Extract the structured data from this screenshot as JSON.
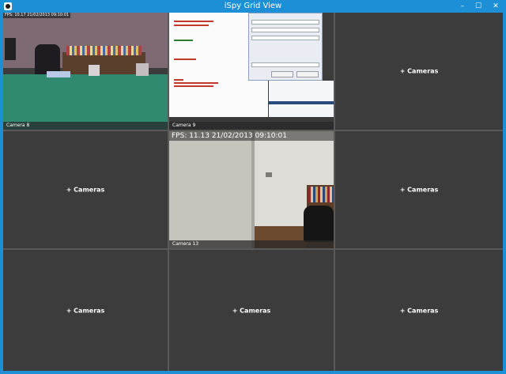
{
  "window": {
    "title": "iSpy Grid View",
    "controls": {
      "minimize": "–",
      "maximize": "☐",
      "close": "✕"
    }
  },
  "colors": {
    "titlebar": "#1c8fd6",
    "cell_background": "#3c3c3c",
    "grid_lines": "#595959"
  },
  "cells": [
    {
      "type": "camera",
      "label": "Camera 8",
      "fps": "FPS: 10.17 21/02/2013 09:10:01"
    },
    {
      "type": "camera",
      "label": "Camera 9",
      "fps": ""
    },
    {
      "type": "empty",
      "label": "+ Cameras"
    },
    {
      "type": "empty",
      "label": "+ Cameras"
    },
    {
      "type": "camera",
      "label": "Camera 13",
      "fps": "FPS: 11.13 21/02/2013 09:10:01"
    },
    {
      "type": "empty",
      "label": "+ Cameras"
    },
    {
      "type": "empty",
      "label": "+ Cameras"
    },
    {
      "type": "empty",
      "label": "+ Cameras"
    },
    {
      "type": "empty",
      "label": "+ Cameras"
    }
  ]
}
